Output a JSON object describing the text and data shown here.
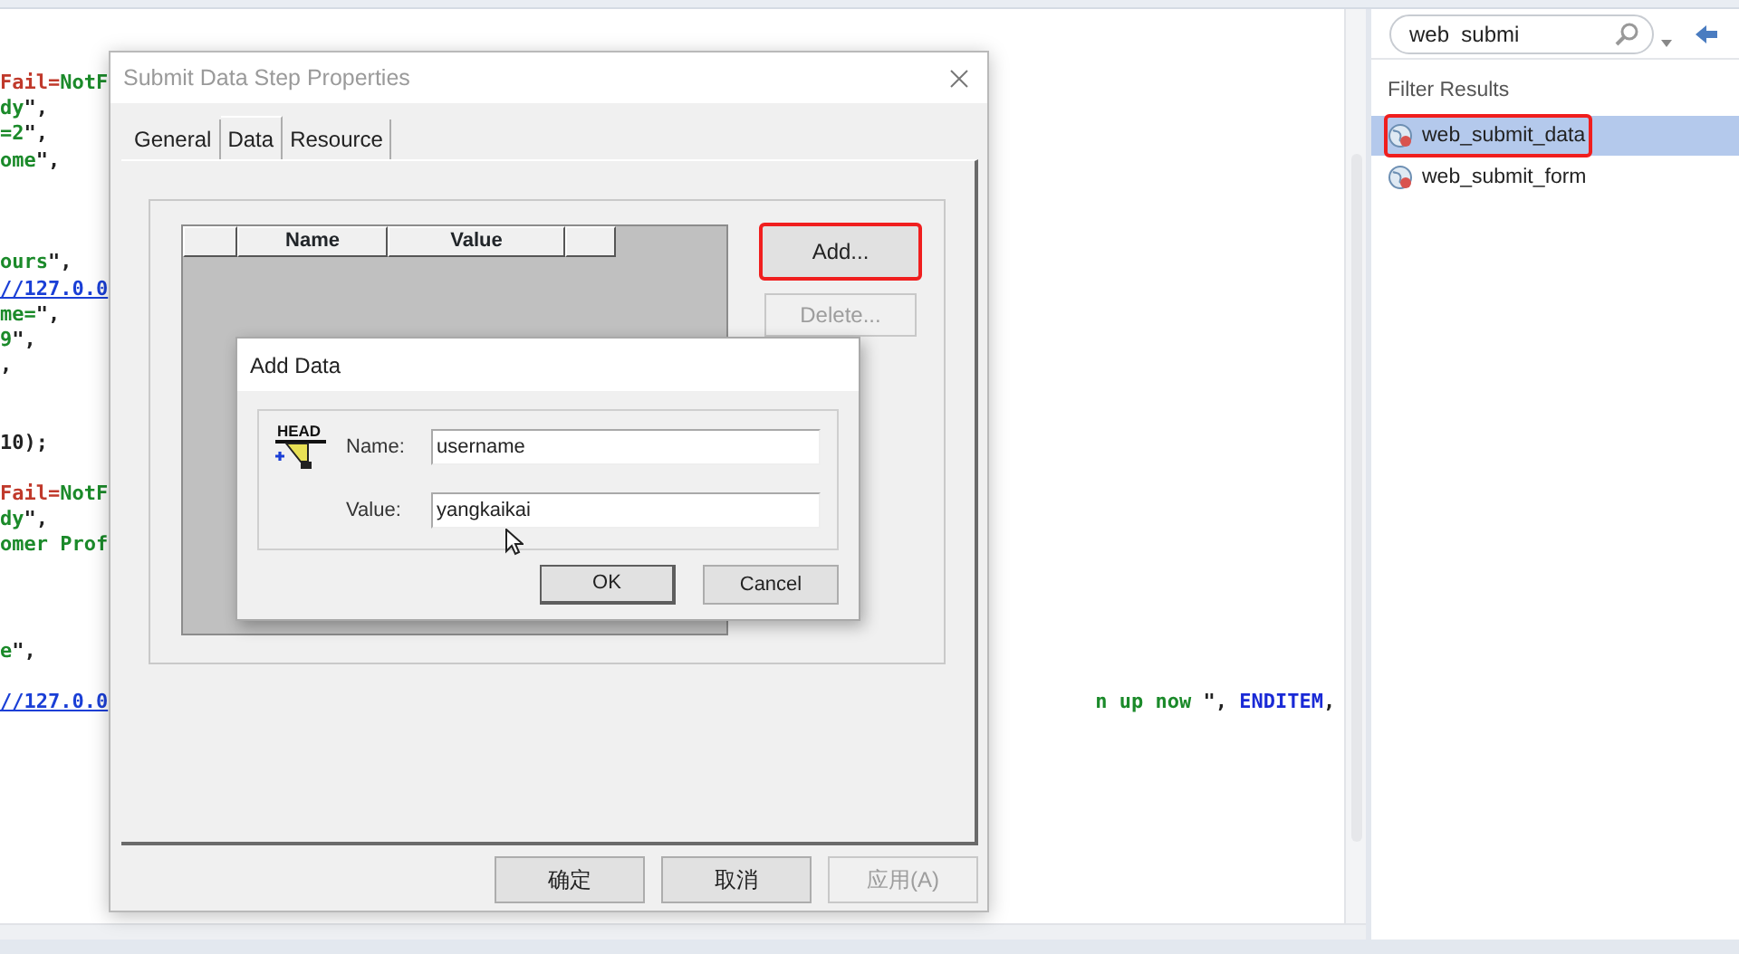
{
  "editor": {
    "blocks": [
      {
        "lines": [
          {
            "segments": [
              {
                "kind": "keyword",
                "text": "Fail="
              },
              {
                "kind": "string",
                "text": "NotF"
              }
            ]
          },
          {
            "segments": [
              {
                "kind": "string",
                "text": "dy"
              },
              {
                "kind": "plain",
                "text": "\","
              }
            ]
          },
          {
            "segments": [
              {
                "kind": "string",
                "text": "=2"
              },
              {
                "kind": "plain",
                "text": "\","
              }
            ]
          },
          {
            "segments": [
              {
                "kind": "string",
                "text": "ome"
              },
              {
                "kind": "plain",
                "text": "\","
              }
            ]
          }
        ]
      },
      {
        "lines": [
          {
            "segments": [
              {
                "kind": "string",
                "text": "ours"
              },
              {
                "kind": "plain",
                "text": "\","
              }
            ]
          },
          {
            "segments": [
              {
                "kind": "link",
                "text": "//127.0.0"
              }
            ]
          },
          {
            "segments": [
              {
                "kind": "string",
                "text": "me="
              },
              {
                "kind": "plain",
                "text": "\","
              }
            ]
          },
          {
            "segments": [
              {
                "kind": "string",
                "text": "9"
              },
              {
                "kind": "plain",
                "text": "\","
              }
            ]
          },
          {
            "segments": [
              {
                "kind": "plain",
                "text": ","
              }
            ]
          }
        ]
      },
      {
        "lines": [
          {
            "segments": [
              {
                "kind": "plain",
                "text": "10);"
              }
            ]
          }
        ]
      },
      {
        "lines": [
          {
            "segments": [
              {
                "kind": "keyword",
                "text": "Fail="
              },
              {
                "kind": "string",
                "text": "NotF"
              }
            ]
          },
          {
            "segments": [
              {
                "kind": "string",
                "text": "dy"
              },
              {
                "kind": "plain",
                "text": "\","
              }
            ]
          },
          {
            "segments": [
              {
                "kind": "string",
                "text": "omer Prof"
              }
            ]
          }
        ]
      },
      {
        "lines": [
          {
            "segments": [
              {
                "kind": "string",
                "text": "e"
              },
              {
                "kind": "plain",
                "text": "\","
              }
            ]
          }
        ]
      },
      {
        "lines": [
          {
            "segments": [
              {
                "kind": "link",
                "text": "//127.0.0"
              }
            ],
            "tail": [
              {
                "kind": "string",
                "text": "n up now "
              },
              {
                "kind": "plain",
                "text": "\", "
              },
              {
                "kind": "constant",
                "text": "ENDITEM"
              },
              {
                "kind": "plain",
                "text": ","
              }
            ]
          }
        ]
      }
    ]
  },
  "search": {
    "value": "web  submi"
  },
  "filter_label": "Filter Results",
  "results": [
    {
      "label": "web_submit_data",
      "selected": true,
      "highlighted": true
    },
    {
      "label": "web_submit_form",
      "selected": false,
      "highlighted": false
    }
  ],
  "properties_dialog": {
    "title": "Submit Data Step Properties",
    "tabs": [
      {
        "label": "General",
        "selected": false
      },
      {
        "label": "Data",
        "selected": true
      },
      {
        "label": "Resource",
        "selected": false
      }
    ],
    "table": {
      "columns": [
        "Name",
        "Value"
      ]
    },
    "side_buttons": [
      {
        "label": "Add...",
        "disabled": false,
        "highlighted": true
      },
      {
        "label": "Delete...",
        "disabled": true,
        "highlighted": false
      }
    ],
    "footer_buttons": [
      {
        "label": "确定",
        "disabled": false
      },
      {
        "label": "取消",
        "disabled": false
      },
      {
        "label": "应用(A)",
        "disabled": true
      }
    ]
  },
  "add_data_dialog": {
    "title": "Add Data",
    "icon_text": "HEAD",
    "fields": [
      {
        "label": "Name:",
        "value": "username"
      },
      {
        "label": "Value:",
        "value": "yangkaikai"
      }
    ],
    "buttons": [
      {
        "label": "OK",
        "default": true
      },
      {
        "label": "Cancel",
        "default": false
      }
    ]
  }
}
